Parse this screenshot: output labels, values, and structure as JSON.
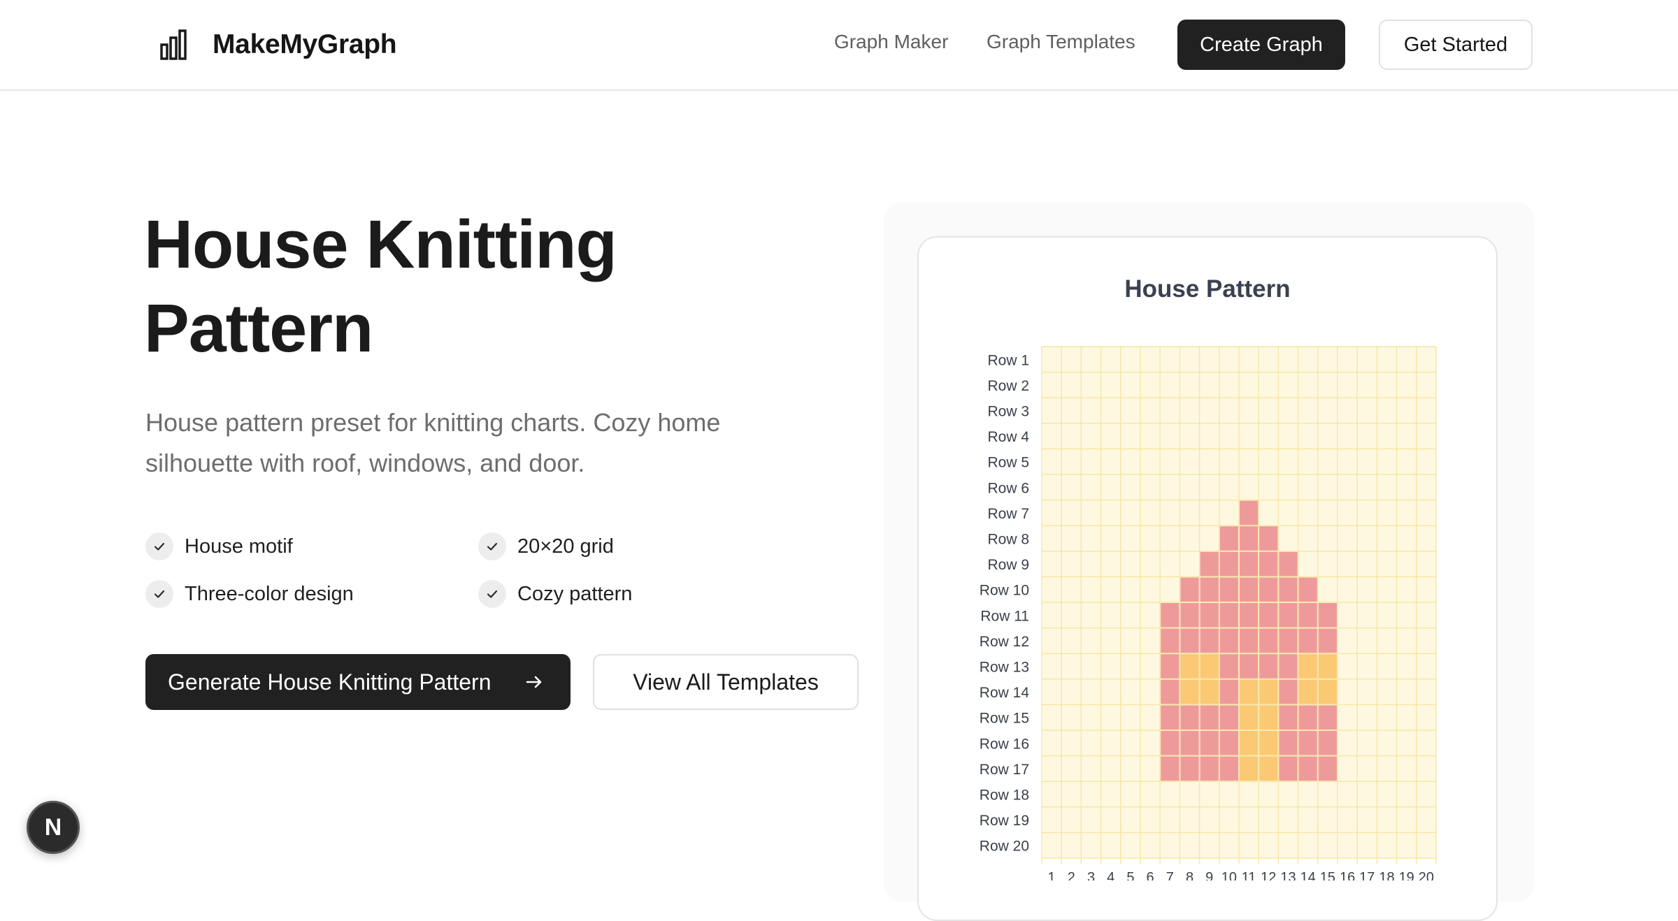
{
  "header": {
    "brand": "MakeMyGraph",
    "nav": [
      "Graph Maker",
      "Graph Templates"
    ],
    "create_label": "Create Graph",
    "started_label": "Get Started"
  },
  "hero": {
    "title": "House Knitting Pattern",
    "description": "House pattern preset for knitting charts. Cozy home silhouette with roof, windows, and door.",
    "features": [
      "House motif",
      "20×20 grid",
      "Three-color design",
      "Cozy pattern"
    ],
    "primary_button": "Generate House Knitting Pattern",
    "secondary_button": "View All Templates"
  },
  "fab_label": "N",
  "colors": {
    "background": "#fff8e1",
    "gridline": "#f6e7a6",
    "house": "#ef9a9a",
    "window_door": "#fbc974"
  },
  "chart_data": {
    "type": "heatmap",
    "title": "House Pattern",
    "rows": [
      "Row 1",
      "Row 2",
      "Row 3",
      "Row 4",
      "Row 5",
      "Row 6",
      "Row 7",
      "Row 8",
      "Row 9",
      "Row 10",
      "Row 11",
      "Row 12",
      "Row 13",
      "Row 14",
      "Row 15",
      "Row 16",
      "Row 17",
      "Row 18",
      "Row 19",
      "Row 20"
    ],
    "columns": [
      "1",
      "2",
      "3",
      "4",
      "5",
      "6",
      "7",
      "8",
      "9",
      "10",
      "11",
      "12",
      "13",
      "14",
      "15",
      "16",
      "17",
      "18",
      "19",
      "20"
    ],
    "legend": {
      "0": "background",
      "1": "house",
      "2": "window_door"
    },
    "grid": [
      [
        0,
        0,
        0,
        0,
        0,
        0,
        0,
        0,
        0,
        0,
        0,
        0,
        0,
        0,
        0,
        0,
        0,
        0,
        0,
        0
      ],
      [
        0,
        0,
        0,
        0,
        0,
        0,
        0,
        0,
        0,
        0,
        0,
        0,
        0,
        0,
        0,
        0,
        0,
        0,
        0,
        0
      ],
      [
        0,
        0,
        0,
        0,
        0,
        0,
        0,
        0,
        0,
        0,
        0,
        0,
        0,
        0,
        0,
        0,
        0,
        0,
        0,
        0
      ],
      [
        0,
        0,
        0,
        0,
        0,
        0,
        0,
        0,
        0,
        0,
        0,
        0,
        0,
        0,
        0,
        0,
        0,
        0,
        0,
        0
      ],
      [
        0,
        0,
        0,
        0,
        0,
        0,
        0,
        0,
        0,
        0,
        0,
        0,
        0,
        0,
        0,
        0,
        0,
        0,
        0,
        0
      ],
      [
        0,
        0,
        0,
        0,
        0,
        0,
        0,
        0,
        0,
        0,
        0,
        0,
        0,
        0,
        0,
        0,
        0,
        0,
        0,
        0
      ],
      [
        0,
        0,
        0,
        0,
        0,
        0,
        0,
        0,
        0,
        0,
        1,
        0,
        0,
        0,
        0,
        0,
        0,
        0,
        0,
        0
      ],
      [
        0,
        0,
        0,
        0,
        0,
        0,
        0,
        0,
        0,
        1,
        1,
        1,
        0,
        0,
        0,
        0,
        0,
        0,
        0,
        0
      ],
      [
        0,
        0,
        0,
        0,
        0,
        0,
        0,
        0,
        1,
        1,
        1,
        1,
        1,
        0,
        0,
        0,
        0,
        0,
        0,
        0
      ],
      [
        0,
        0,
        0,
        0,
        0,
        0,
        0,
        1,
        1,
        1,
        1,
        1,
        1,
        1,
        0,
        0,
        0,
        0,
        0,
        0
      ],
      [
        0,
        0,
        0,
        0,
        0,
        0,
        1,
        1,
        1,
        1,
        1,
        1,
        1,
        1,
        1,
        0,
        0,
        0,
        0,
        0
      ],
      [
        0,
        0,
        0,
        0,
        0,
        0,
        1,
        1,
        1,
        1,
        1,
        1,
        1,
        1,
        1,
        0,
        0,
        0,
        0,
        0
      ],
      [
        0,
        0,
        0,
        0,
        0,
        0,
        1,
        2,
        2,
        1,
        1,
        1,
        1,
        2,
        2,
        0,
        0,
        0,
        0,
        0
      ],
      [
        0,
        0,
        0,
        0,
        0,
        0,
        1,
        2,
        2,
        1,
        2,
        2,
        1,
        2,
        2,
        0,
        0,
        0,
        0,
        0
      ],
      [
        0,
        0,
        0,
        0,
        0,
        0,
        1,
        1,
        1,
        1,
        2,
        2,
        1,
        1,
        1,
        0,
        0,
        0,
        0,
        0
      ],
      [
        0,
        0,
        0,
        0,
        0,
        0,
        1,
        1,
        1,
        1,
        2,
        2,
        1,
        1,
        1,
        0,
        0,
        0,
        0,
        0
      ],
      [
        0,
        0,
        0,
        0,
        0,
        0,
        1,
        1,
        1,
        1,
        2,
        2,
        1,
        1,
        1,
        0,
        0,
        0,
        0,
        0
      ],
      [
        0,
        0,
        0,
        0,
        0,
        0,
        0,
        0,
        0,
        0,
        0,
        0,
        0,
        0,
        0,
        0,
        0,
        0,
        0,
        0
      ],
      [
        0,
        0,
        0,
        0,
        0,
        0,
        0,
        0,
        0,
        0,
        0,
        0,
        0,
        0,
        0,
        0,
        0,
        0,
        0,
        0
      ],
      [
        0,
        0,
        0,
        0,
        0,
        0,
        0,
        0,
        0,
        0,
        0,
        0,
        0,
        0,
        0,
        0,
        0,
        0,
        0,
        0
      ]
    ]
  }
}
